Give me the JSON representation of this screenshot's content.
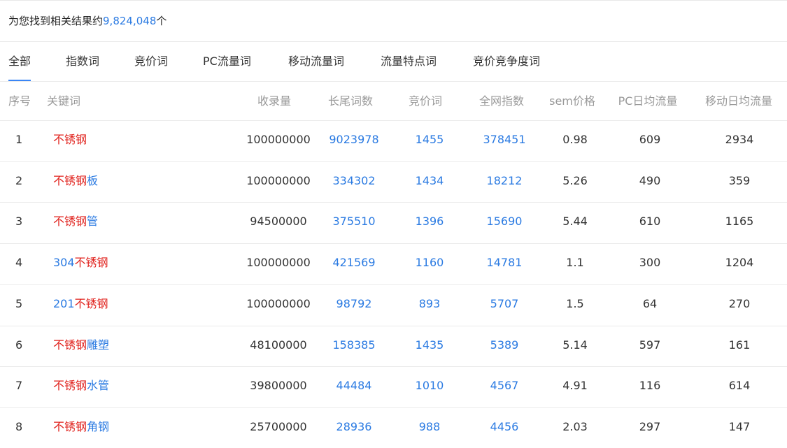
{
  "summary": {
    "prefix": "为您找到相关结果约",
    "count": "9,824,048",
    "suffix": "个"
  },
  "tabs": [
    {
      "label": "全部",
      "active": true
    },
    {
      "label": "指数词",
      "active": false
    },
    {
      "label": "竞价词",
      "active": false
    },
    {
      "label": "PC流量词",
      "active": false
    },
    {
      "label": "移动流量词",
      "active": false
    },
    {
      "label": "流量特点词",
      "active": false
    },
    {
      "label": "竞价竞争度词",
      "active": false
    }
  ],
  "colors": {
    "accent": "#2a7ae2",
    "keyword_highlight": "#e0201b",
    "header_text": "#999999"
  },
  "table": {
    "headers": [
      "序号",
      "关键词",
      "收录量",
      "长尾词数",
      "竞价词",
      "全网指数",
      "sem价格",
      "PC日均流量",
      "移动日均流量"
    ],
    "rows": [
      {
        "index": "1",
        "kw_pre": "",
        "kw_core": "不锈钢",
        "kw_post": "",
        "indexed": "100000000",
        "longtail": "9023978",
        "bid_words": "1455",
        "web_index": "378451",
        "sem_price": "0.98",
        "pc_traffic": "609",
        "mobile_traffic": "2934"
      },
      {
        "index": "2",
        "kw_pre": "",
        "kw_core": "不锈钢",
        "kw_post": "板",
        "indexed": "100000000",
        "longtail": "334302",
        "bid_words": "1434",
        "web_index": "18212",
        "sem_price": "5.26",
        "pc_traffic": "490",
        "mobile_traffic": "359"
      },
      {
        "index": "3",
        "kw_pre": "",
        "kw_core": "不锈钢",
        "kw_post": "管",
        "indexed": "94500000",
        "longtail": "375510",
        "bid_words": "1396",
        "web_index": "15690",
        "sem_price": "5.44",
        "pc_traffic": "610",
        "mobile_traffic": "1165"
      },
      {
        "index": "4",
        "kw_pre": "304",
        "kw_core": "不锈钢",
        "kw_post": "",
        "indexed": "100000000",
        "longtail": "421569",
        "bid_words": "1160",
        "web_index": "14781",
        "sem_price": "1.1",
        "pc_traffic": "300",
        "mobile_traffic": "1204"
      },
      {
        "index": "5",
        "kw_pre": "201",
        "kw_core": "不锈钢",
        "kw_post": "",
        "indexed": "100000000",
        "longtail": "98792",
        "bid_words": "893",
        "web_index": "5707",
        "sem_price": "1.5",
        "pc_traffic": "64",
        "mobile_traffic": "270"
      },
      {
        "index": "6",
        "kw_pre": "",
        "kw_core": "不锈钢",
        "kw_post": "雕塑",
        "indexed": "48100000",
        "longtail": "158385",
        "bid_words": "1435",
        "web_index": "5389",
        "sem_price": "5.14",
        "pc_traffic": "597",
        "mobile_traffic": "161"
      },
      {
        "index": "7",
        "kw_pre": "",
        "kw_core": "不锈钢",
        "kw_post": "水管",
        "indexed": "39800000",
        "longtail": "44484",
        "bid_words": "1010",
        "web_index": "4567",
        "sem_price": "4.91",
        "pc_traffic": "116",
        "mobile_traffic": "614"
      },
      {
        "index": "8",
        "kw_pre": "",
        "kw_core": "不锈钢",
        "kw_post": "角钢",
        "indexed": "25700000",
        "longtail": "28936",
        "bid_words": "988",
        "web_index": "4456",
        "sem_price": "2.03",
        "pc_traffic": "297",
        "mobile_traffic": "147"
      }
    ]
  }
}
